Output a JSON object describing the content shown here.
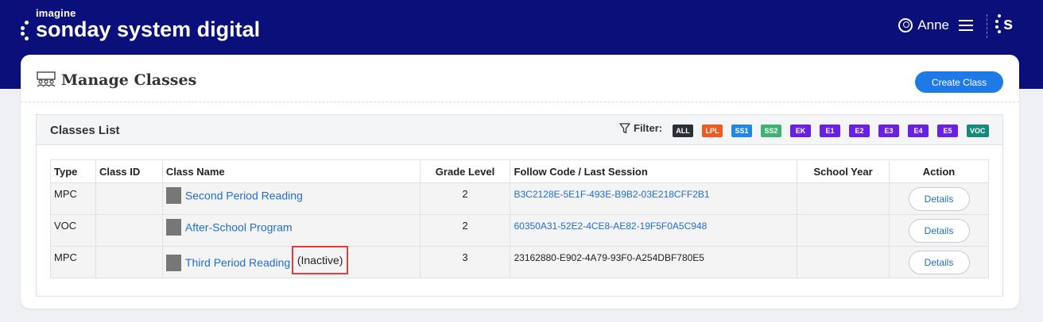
{
  "header": {
    "logo_small": "imagine",
    "logo_main": "sonday system digital",
    "user_name": "Anne",
    "brand_letter": "s",
    "colors": {
      "navy": "#0a0f7a",
      "accent": "#1f7ae8"
    }
  },
  "page": {
    "title": "Manage Classes",
    "create_label": "Create Class"
  },
  "classes_panel": {
    "title": "Classes List",
    "filter_label": "Filter:",
    "filters": [
      {
        "label": "ALL",
        "color": "#2b2f36"
      },
      {
        "label": "LPL",
        "color": "#ef5a1e"
      },
      {
        "label": "SS1",
        "color": "#1f88e5"
      },
      {
        "label": "SS2",
        "color": "#3cb371"
      },
      {
        "label": "EK",
        "color": "#6a1fe6"
      },
      {
        "label": "E1",
        "color": "#6a1fe6"
      },
      {
        "label": "E2",
        "color": "#6a1fe6"
      },
      {
        "label": "E3",
        "color": "#6a1fe6"
      },
      {
        "label": "E4",
        "color": "#6a1fe6"
      },
      {
        "label": "E5",
        "color": "#6a1fe6"
      },
      {
        "label": "VOC",
        "color": "#168a7a"
      }
    ]
  },
  "table": {
    "headers": {
      "type": "Type",
      "class_id": "Class ID",
      "class_name": "Class Name",
      "grade_level": "Grade Level",
      "follow_code": "Follow Code / Last Session",
      "school_year": "School Year",
      "action": "Action"
    },
    "rows": [
      {
        "type": "MPC",
        "class_id": "",
        "class_name": "Second Period Reading",
        "status": "",
        "grade_level": "2",
        "follow_code": "B3C2128E-5E1F-493E-B9B2-03E218CFF2B1",
        "school_year": "",
        "action": "Details"
      },
      {
        "type": "VOC",
        "class_id": "",
        "class_name": "After-School Program",
        "status": "",
        "grade_level": "2",
        "follow_code": "60350A31-52E2-4CE8-AE82-19F5F0A5C948",
        "school_year": "",
        "action": "Details"
      },
      {
        "type": "MPC",
        "class_id": "",
        "class_name": "Third Period Reading",
        "status": "(Inactive)",
        "grade_level": "3",
        "follow_code": "23162880-E902-4A79-93F0-A254DBF780E5",
        "school_year": "",
        "action": "Details"
      }
    ]
  }
}
